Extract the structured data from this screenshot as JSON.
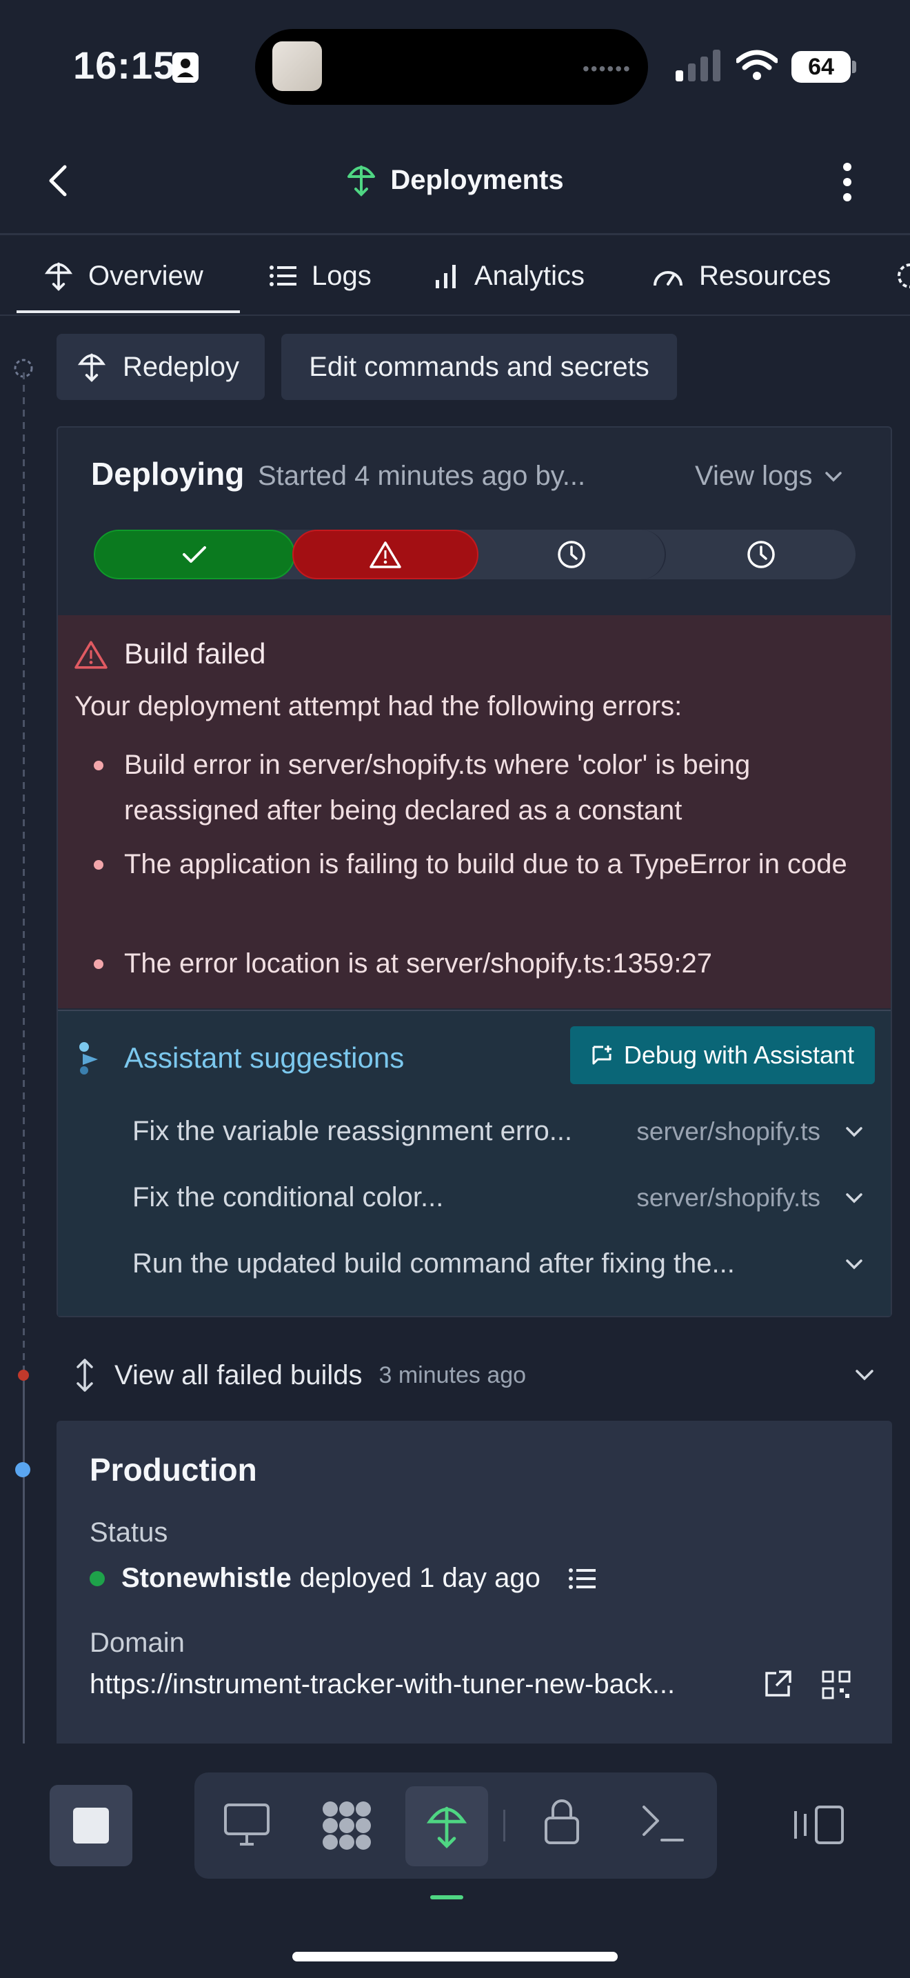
{
  "status_bar": {
    "time": "16:15",
    "battery": "64"
  },
  "header": {
    "title": "Deployments"
  },
  "tabs": [
    {
      "label": "Overview",
      "active": true
    },
    {
      "label": "Logs"
    },
    {
      "label": "Analytics"
    },
    {
      "label": "Resources"
    }
  ],
  "actions": {
    "redeploy": "Redeploy",
    "edit": "Edit commands and secrets"
  },
  "deploy": {
    "status": "Deploying",
    "started": "Started 4 minutes ago by...",
    "view_logs": "View logs",
    "error": {
      "title": "Build failed",
      "intro": "Your deployment attempt had the following errors:",
      "items": [
        "Build error in server/shopify.ts where 'color' is being reassigned after being declared as a constant",
        "The application is failing to build due to a TypeError in code",
        "The error location is at server/shopify.ts:1359:27"
      ]
    },
    "assistant": {
      "title": "Assistant suggestions",
      "debug_button": "Debug with Assistant",
      "suggestions": [
        {
          "text": "Fix the variable reassignment erro...",
          "path": "server/shopify.ts"
        },
        {
          "text": "Fix the conditional color...",
          "path": "server/shopify.ts"
        },
        {
          "text": "Run the updated build command after fixing the...",
          "path": ""
        }
      ]
    }
  },
  "failed_builds": {
    "label": "View all failed builds",
    "time": "3 minutes ago"
  },
  "production": {
    "title": "Production",
    "status_label": "Status",
    "deployer": "Stonewhistle",
    "deployed_text": "deployed 1 day ago",
    "domain_label": "Domain",
    "domain": "https://instrument-tracker-with-tuner-new-back..."
  },
  "colors": {
    "background": "#1c2230",
    "success": "#0b7a1f",
    "error": "#a30f13",
    "accent_teal": "#0a6677",
    "link_blue": "#7cc8ee",
    "deploy_green": "#4fd683",
    "online_dot": "#1ea24a"
  }
}
